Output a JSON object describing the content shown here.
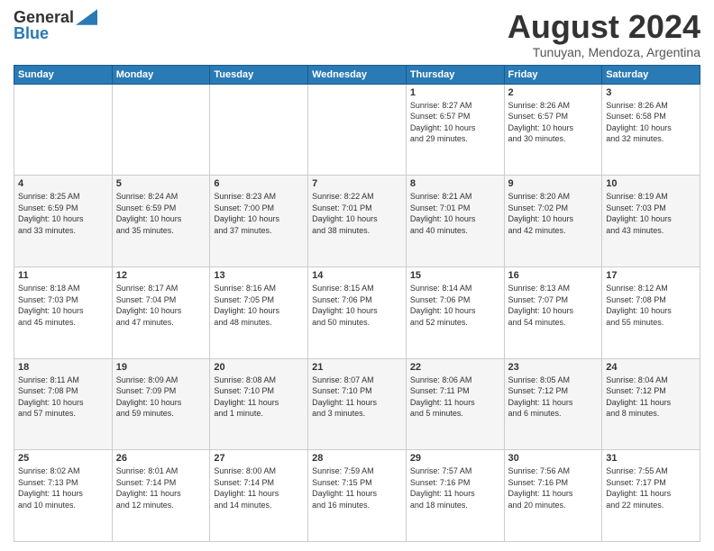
{
  "logo": {
    "general": "General",
    "blue": "Blue"
  },
  "header": {
    "month_year": "August 2024",
    "location": "Tunuyan, Mendoza, Argentina"
  },
  "weekdays": [
    "Sunday",
    "Monday",
    "Tuesday",
    "Wednesday",
    "Thursday",
    "Friday",
    "Saturday"
  ],
  "weeks": [
    [
      {
        "day": "",
        "content": ""
      },
      {
        "day": "",
        "content": ""
      },
      {
        "day": "",
        "content": ""
      },
      {
        "day": "",
        "content": ""
      },
      {
        "day": "1",
        "content": "Sunrise: 8:27 AM\nSunset: 6:57 PM\nDaylight: 10 hours\nand 29 minutes."
      },
      {
        "day": "2",
        "content": "Sunrise: 8:26 AM\nSunset: 6:57 PM\nDaylight: 10 hours\nand 30 minutes."
      },
      {
        "day": "3",
        "content": "Sunrise: 8:26 AM\nSunset: 6:58 PM\nDaylight: 10 hours\nand 32 minutes."
      }
    ],
    [
      {
        "day": "4",
        "content": "Sunrise: 8:25 AM\nSunset: 6:59 PM\nDaylight: 10 hours\nand 33 minutes."
      },
      {
        "day": "5",
        "content": "Sunrise: 8:24 AM\nSunset: 6:59 PM\nDaylight: 10 hours\nand 35 minutes."
      },
      {
        "day": "6",
        "content": "Sunrise: 8:23 AM\nSunset: 7:00 PM\nDaylight: 10 hours\nand 37 minutes."
      },
      {
        "day": "7",
        "content": "Sunrise: 8:22 AM\nSunset: 7:01 PM\nDaylight: 10 hours\nand 38 minutes."
      },
      {
        "day": "8",
        "content": "Sunrise: 8:21 AM\nSunset: 7:01 PM\nDaylight: 10 hours\nand 40 minutes."
      },
      {
        "day": "9",
        "content": "Sunrise: 8:20 AM\nSunset: 7:02 PM\nDaylight: 10 hours\nand 42 minutes."
      },
      {
        "day": "10",
        "content": "Sunrise: 8:19 AM\nSunset: 7:03 PM\nDaylight: 10 hours\nand 43 minutes."
      }
    ],
    [
      {
        "day": "11",
        "content": "Sunrise: 8:18 AM\nSunset: 7:03 PM\nDaylight: 10 hours\nand 45 minutes."
      },
      {
        "day": "12",
        "content": "Sunrise: 8:17 AM\nSunset: 7:04 PM\nDaylight: 10 hours\nand 47 minutes."
      },
      {
        "day": "13",
        "content": "Sunrise: 8:16 AM\nSunset: 7:05 PM\nDaylight: 10 hours\nand 48 minutes."
      },
      {
        "day": "14",
        "content": "Sunrise: 8:15 AM\nSunset: 7:06 PM\nDaylight: 10 hours\nand 50 minutes."
      },
      {
        "day": "15",
        "content": "Sunrise: 8:14 AM\nSunset: 7:06 PM\nDaylight: 10 hours\nand 52 minutes."
      },
      {
        "day": "16",
        "content": "Sunrise: 8:13 AM\nSunset: 7:07 PM\nDaylight: 10 hours\nand 54 minutes."
      },
      {
        "day": "17",
        "content": "Sunrise: 8:12 AM\nSunset: 7:08 PM\nDaylight: 10 hours\nand 55 minutes."
      }
    ],
    [
      {
        "day": "18",
        "content": "Sunrise: 8:11 AM\nSunset: 7:08 PM\nDaylight: 10 hours\nand 57 minutes."
      },
      {
        "day": "19",
        "content": "Sunrise: 8:09 AM\nSunset: 7:09 PM\nDaylight: 10 hours\nand 59 minutes."
      },
      {
        "day": "20",
        "content": "Sunrise: 8:08 AM\nSunset: 7:10 PM\nDaylight: 11 hours\nand 1 minute."
      },
      {
        "day": "21",
        "content": "Sunrise: 8:07 AM\nSunset: 7:10 PM\nDaylight: 11 hours\nand 3 minutes."
      },
      {
        "day": "22",
        "content": "Sunrise: 8:06 AM\nSunset: 7:11 PM\nDaylight: 11 hours\nand 5 minutes."
      },
      {
        "day": "23",
        "content": "Sunrise: 8:05 AM\nSunset: 7:12 PM\nDaylight: 11 hours\nand 6 minutes."
      },
      {
        "day": "24",
        "content": "Sunrise: 8:04 AM\nSunset: 7:12 PM\nDaylight: 11 hours\nand 8 minutes."
      }
    ],
    [
      {
        "day": "25",
        "content": "Sunrise: 8:02 AM\nSunset: 7:13 PM\nDaylight: 11 hours\nand 10 minutes."
      },
      {
        "day": "26",
        "content": "Sunrise: 8:01 AM\nSunset: 7:14 PM\nDaylight: 11 hours\nand 12 minutes."
      },
      {
        "day": "27",
        "content": "Sunrise: 8:00 AM\nSunset: 7:14 PM\nDaylight: 11 hours\nand 14 minutes."
      },
      {
        "day": "28",
        "content": "Sunrise: 7:59 AM\nSunset: 7:15 PM\nDaylight: 11 hours\nand 16 minutes."
      },
      {
        "day": "29",
        "content": "Sunrise: 7:57 AM\nSunset: 7:16 PM\nDaylight: 11 hours\nand 18 minutes."
      },
      {
        "day": "30",
        "content": "Sunrise: 7:56 AM\nSunset: 7:16 PM\nDaylight: 11 hours\nand 20 minutes."
      },
      {
        "day": "31",
        "content": "Sunrise: 7:55 AM\nSunset: 7:17 PM\nDaylight: 11 hours\nand 22 minutes."
      }
    ]
  ]
}
